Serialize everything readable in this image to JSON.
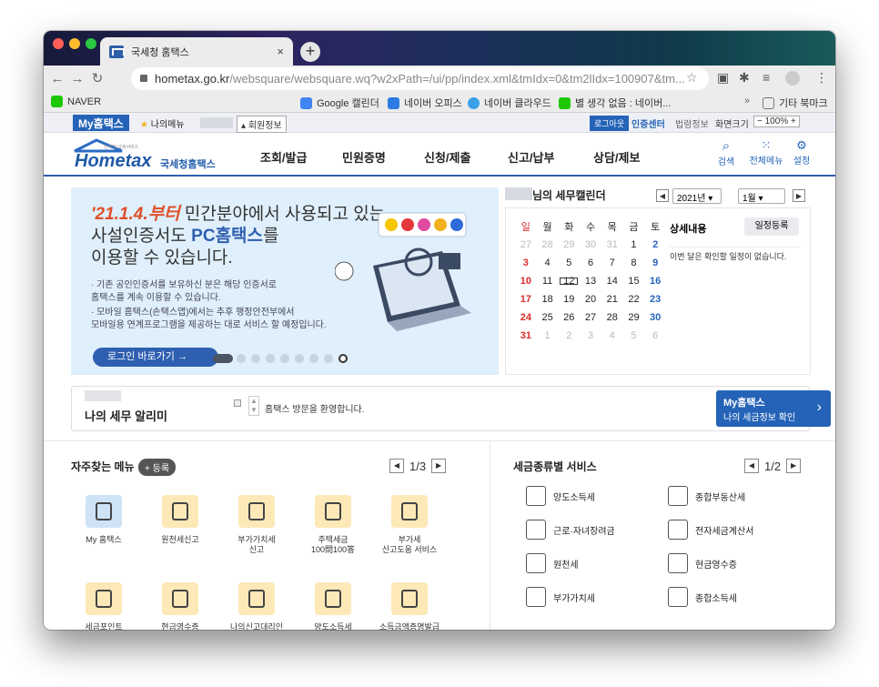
{
  "browser": {
    "tab_title": "국세청 홈택스",
    "tab_close": "×",
    "new_tab": "+",
    "url_host": "hometax.go.kr",
    "url_path": "/websquare/websquare.wq?w2xPath=/ui/pp/index.xml&tmIdx=0&tm2lIdx=100907&tm...",
    "bookmarks": [
      "NAVER",
      "Google 캘린더",
      "네이버 오피스",
      "네이버 클라우드",
      "별 생각 없음 : 네이버...",
      "»",
      "기타 북마크"
    ]
  },
  "topbar": {
    "myhome": "My홈택스",
    "mymenu": "★ 나의메뉴",
    "member_info": "회원정보",
    "logout": "로그아웃",
    "cert": "인증센터",
    "legal": "법령정보",
    "screen_size": "화면크기",
    "zoom": "100%"
  },
  "logo": {
    "main": "Hometax",
    "sub": "국세청홈택스",
    "tiny": "전자적 납세서비스"
  },
  "gnb": [
    "조회/발급",
    "민원증명",
    "신청/제출",
    "신고/납부",
    "상담/제보"
  ],
  "gnb_icons": [
    {
      "label": "검색",
      "icon": "search-icon"
    },
    {
      "label": "전체메뉴",
      "icon": "grid-icon"
    },
    {
      "label": "설정",
      "icon": "gear-icon"
    }
  ],
  "banner": {
    "line1_emph": "'21.1.4.부터",
    "line1_rest": " 민간분야에서 사용되고 있는",
    "line2_pre": "사설인증서도 ",
    "line2_emph": "PC홈택스",
    "line2_post": "를",
    "line3": "이용할 수 있습니다.",
    "bullets": [
      "· 기존 공인인증서를 보유하신 분은 해당 인증서로",
      "  홈택스를 계속 이용할 수 있습니다.",
      "· 모바일 홈택스(손택스앱)에서는 추후 행정안전부에서",
      "  모바일용 연계프로그램을 제공하는 대로 서비스 할 예정입니다."
    ],
    "button": "로그인 바로가기 →"
  },
  "calendar": {
    "title": "님의 세무캘린더",
    "year": "2021년",
    "month": "1월",
    "weekdays": [
      "일",
      "월",
      "화",
      "수",
      "목",
      "금",
      "토"
    ],
    "weeks": [
      [
        "27",
        "28",
        "29",
        "30",
        "31",
        "1",
        "2"
      ],
      [
        "3",
        "4",
        "5",
        "6",
        "7",
        "8",
        "9"
      ],
      [
        "10",
        "11",
        "12",
        "13",
        "14",
        "15",
        "16"
      ],
      [
        "17",
        "18",
        "19",
        "20",
        "21",
        "22",
        "23"
      ],
      [
        "24",
        "25",
        "26",
        "27",
        "28",
        "29",
        "30"
      ],
      [
        "31",
        "1",
        "2",
        "3",
        "4",
        "5",
        "6"
      ]
    ],
    "today": "12",
    "detail_title": "상세내용",
    "register_button": "일정등록",
    "empty_text": "이번 달은 확인할 일정이 없습니다."
  },
  "notice": {
    "title": "나의 세무 알리미",
    "message": "홈택스 방문을 환영합니다.",
    "myhome_title": "My홈택스",
    "myhome_sub": "나의 세금정보 확인",
    "arrow": "›"
  },
  "freq": {
    "title": "자주찾는 메뉴",
    "add": "+ 등록",
    "page": "1/3",
    "items": [
      {
        "label": "My 홈택스",
        "icon": "person-icon"
      },
      {
        "label": "원천세신고",
        "icon": "calendar-pen-icon"
      },
      {
        "label": "부가가치세\n신고",
        "icon": "vat-pen-icon"
      },
      {
        "label": "주택세금\n100問100答",
        "icon": "building-icon"
      },
      {
        "label": "부가세\n신고도움 서비스",
        "icon": "vat-search-icon"
      },
      {
        "label": "세금포인트",
        "icon": "tax-bag-icon"
      },
      {
        "label": "현금영수증",
        "icon": "receipt-search-icon"
      },
      {
        "label": "나의신고대리인",
        "icon": "document-pen-icon"
      },
      {
        "label": "양도소득세",
        "icon": "house-pen-icon"
      },
      {
        "label": "소득금액증명발급",
        "icon": "certificate-icon"
      }
    ]
  },
  "services": {
    "title": "세금종류별 서비스",
    "page": "1/2",
    "items": [
      {
        "label": "양도소득세",
        "icon": "transfer-icon"
      },
      {
        "label": "종합부동산세",
        "icon": "realestate-icon"
      },
      {
        "label": "근로·자녀장려금",
        "icon": "heart-icon"
      },
      {
        "label": "전자세금계산서",
        "icon": "invoice-icon"
      },
      {
        "label": "원천세",
        "icon": "withholding-icon"
      },
      {
        "label": "현금영수증",
        "icon": "cash-receipt-icon"
      },
      {
        "label": "부가가치세",
        "icon": "vat-icon"
      },
      {
        "label": "종합소득세",
        "icon": "income-icon"
      }
    ]
  }
}
